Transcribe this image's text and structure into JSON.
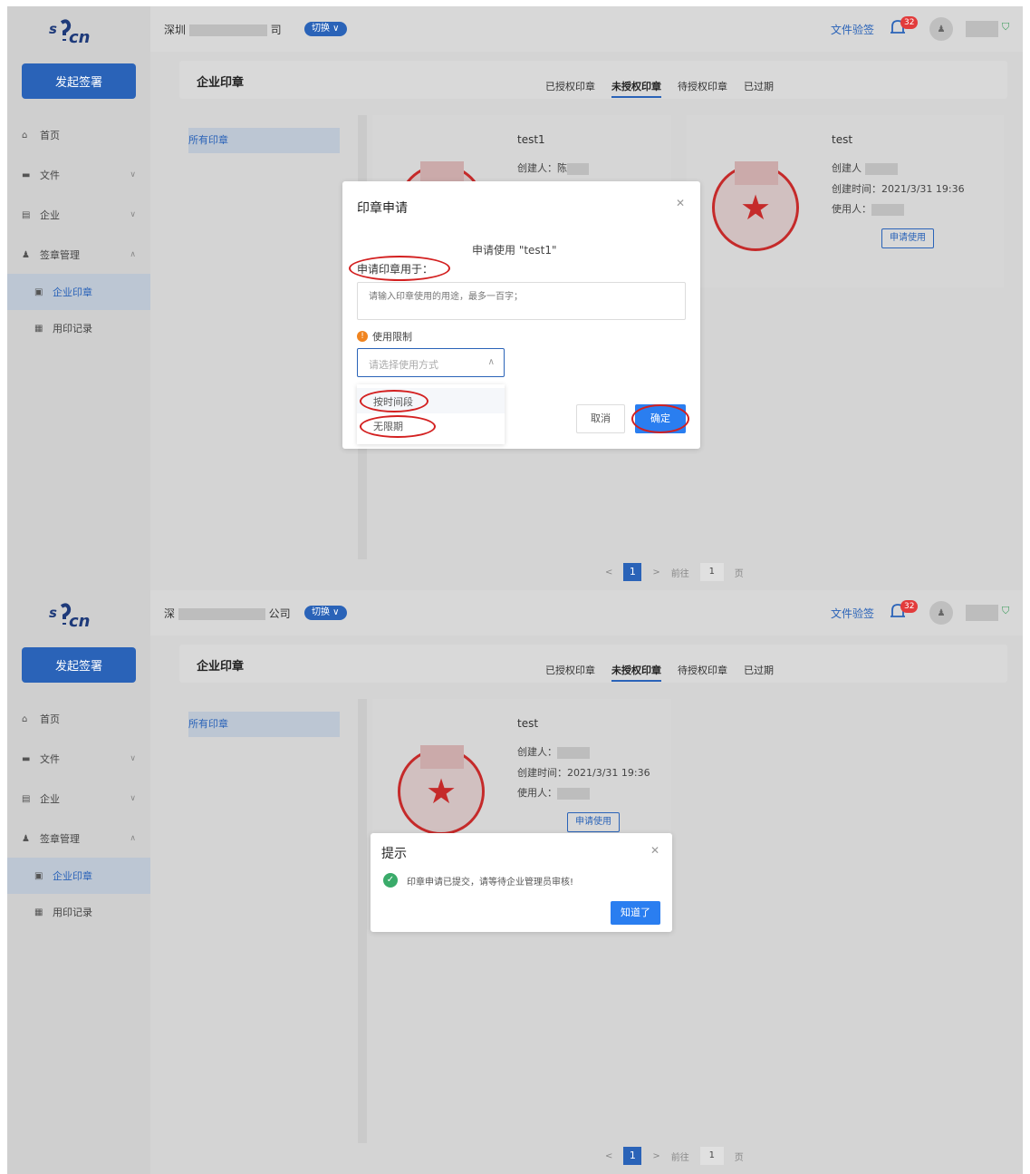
{
  "logo": {
    "text": "ᴱᶜᴬ"
  },
  "header": {
    "company_prefix": "深圳",
    "company_suffix": "司",
    "company_prefix_2": "深",
    "company_suffix_2": "公司",
    "switch_label": "切换 ∨",
    "verify_label": "文件验签",
    "notification_count": "32"
  },
  "sidebar": {
    "start_label": "发起签署",
    "items": [
      {
        "label": "首页",
        "icon": "home-icon"
      },
      {
        "label": "文件",
        "icon": "folder-icon"
      },
      {
        "label": "企业",
        "icon": "building-icon"
      },
      {
        "label": "签章管理",
        "icon": "seal-manage-icon"
      },
      {
        "label": "企业印章",
        "icon": "stamp-icon"
      },
      {
        "label": "用印记录",
        "icon": "record-icon"
      }
    ]
  },
  "page": {
    "title": "企业印章",
    "tabs": [
      "已授权印章",
      "未授权印章",
      "待授权印章",
      "已过期"
    ],
    "active_tab": "未授权印章",
    "filter_label": "所有印章"
  },
  "panel1": {
    "card1": {
      "title": "test1",
      "creator_label": "创建人：陈"
    },
    "card2": {
      "title": "test",
      "creator_label": "创建人",
      "created_time": "创建时间：2021/3/31 19:36",
      "user_label": "使用人：",
      "apply_label": "申请使用"
    }
  },
  "apply_dialog": {
    "title": "印章申请",
    "apply_text": "申请使用 \"test1\"",
    "purpose_label": "申请印章用于：",
    "purpose_placeholder": "请输入印章使用的用途，最多一百字；",
    "limit_label": "使用限制",
    "select_placeholder": "请选择使用方式",
    "options": [
      "按时间段",
      "无限期"
    ],
    "cancel_label": "取消",
    "confirm_label": "确定"
  },
  "panel2": {
    "card1": {
      "title": "test",
      "creator_label": "创建人：",
      "created_time": "创建时间：2021/3/31 19:36",
      "user_label": "使用人：",
      "apply_label": "申请使用"
    }
  },
  "notice_dialog": {
    "title": "提示",
    "message": "印章申请已提交，请等待企业管理员审核!",
    "ok_label": "知道了"
  },
  "pager": {
    "prev": "<",
    "page": "1",
    "next": ">",
    "goto_label": "前往",
    "goto_value": "1",
    "page_suffix": "页"
  },
  "colors": {
    "primary": "#2a63b8",
    "highlight": "#d32020",
    "success": "#3a9b5a"
  }
}
